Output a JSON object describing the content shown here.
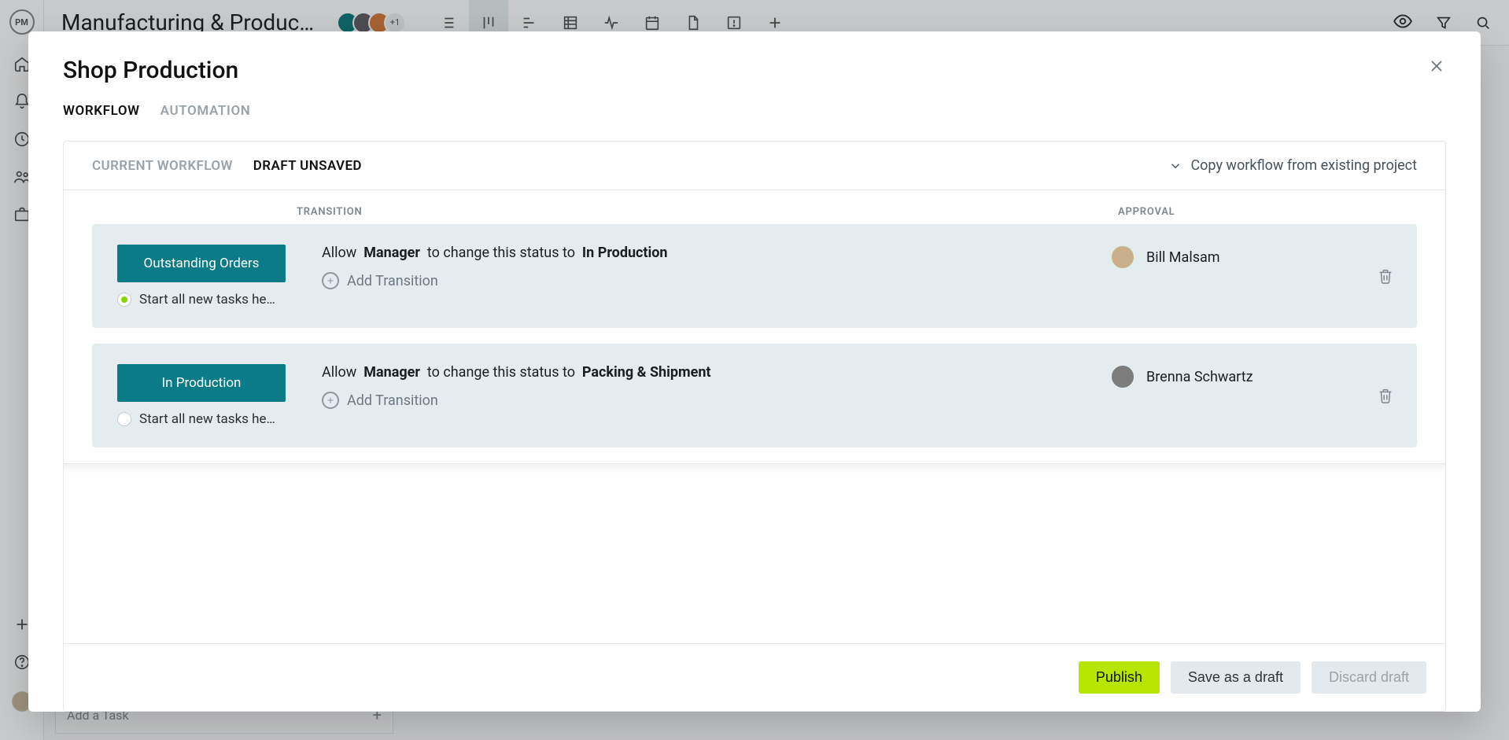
{
  "app": {
    "project_title": "Manufacturing & Producti…",
    "avatar_more": "+1",
    "add_task_placeholder": "Add a Task"
  },
  "modal": {
    "title": "Shop Production",
    "tabs": {
      "workflow": "WORKFLOW",
      "automation": "AUTOMATION"
    },
    "segments": {
      "current": "CURRENT WORKFLOW",
      "draft": "DRAFT UNSAVED"
    },
    "copy_link": "Copy workflow from existing project",
    "columns": {
      "transition": "TRANSITION",
      "approval": "APPROVAL"
    },
    "add_transition": "Add Transition",
    "start_here": "Start all new tasks he…",
    "allow_prefix": "Allow",
    "allow_mid": "to change this status to",
    "rows": [
      {
        "status": "Outstanding Orders",
        "role": "Manager",
        "target": "In Production",
        "approver": "Bill Malsam",
        "start_checked": true
      },
      {
        "status": "In Production",
        "role": "Manager",
        "target": "Packing & Shipment",
        "approver": "Brenna Schwartz",
        "start_checked": false
      }
    ],
    "buttons": {
      "publish": "Publish",
      "save_draft": "Save as a draft",
      "discard": "Discard draft"
    }
  }
}
